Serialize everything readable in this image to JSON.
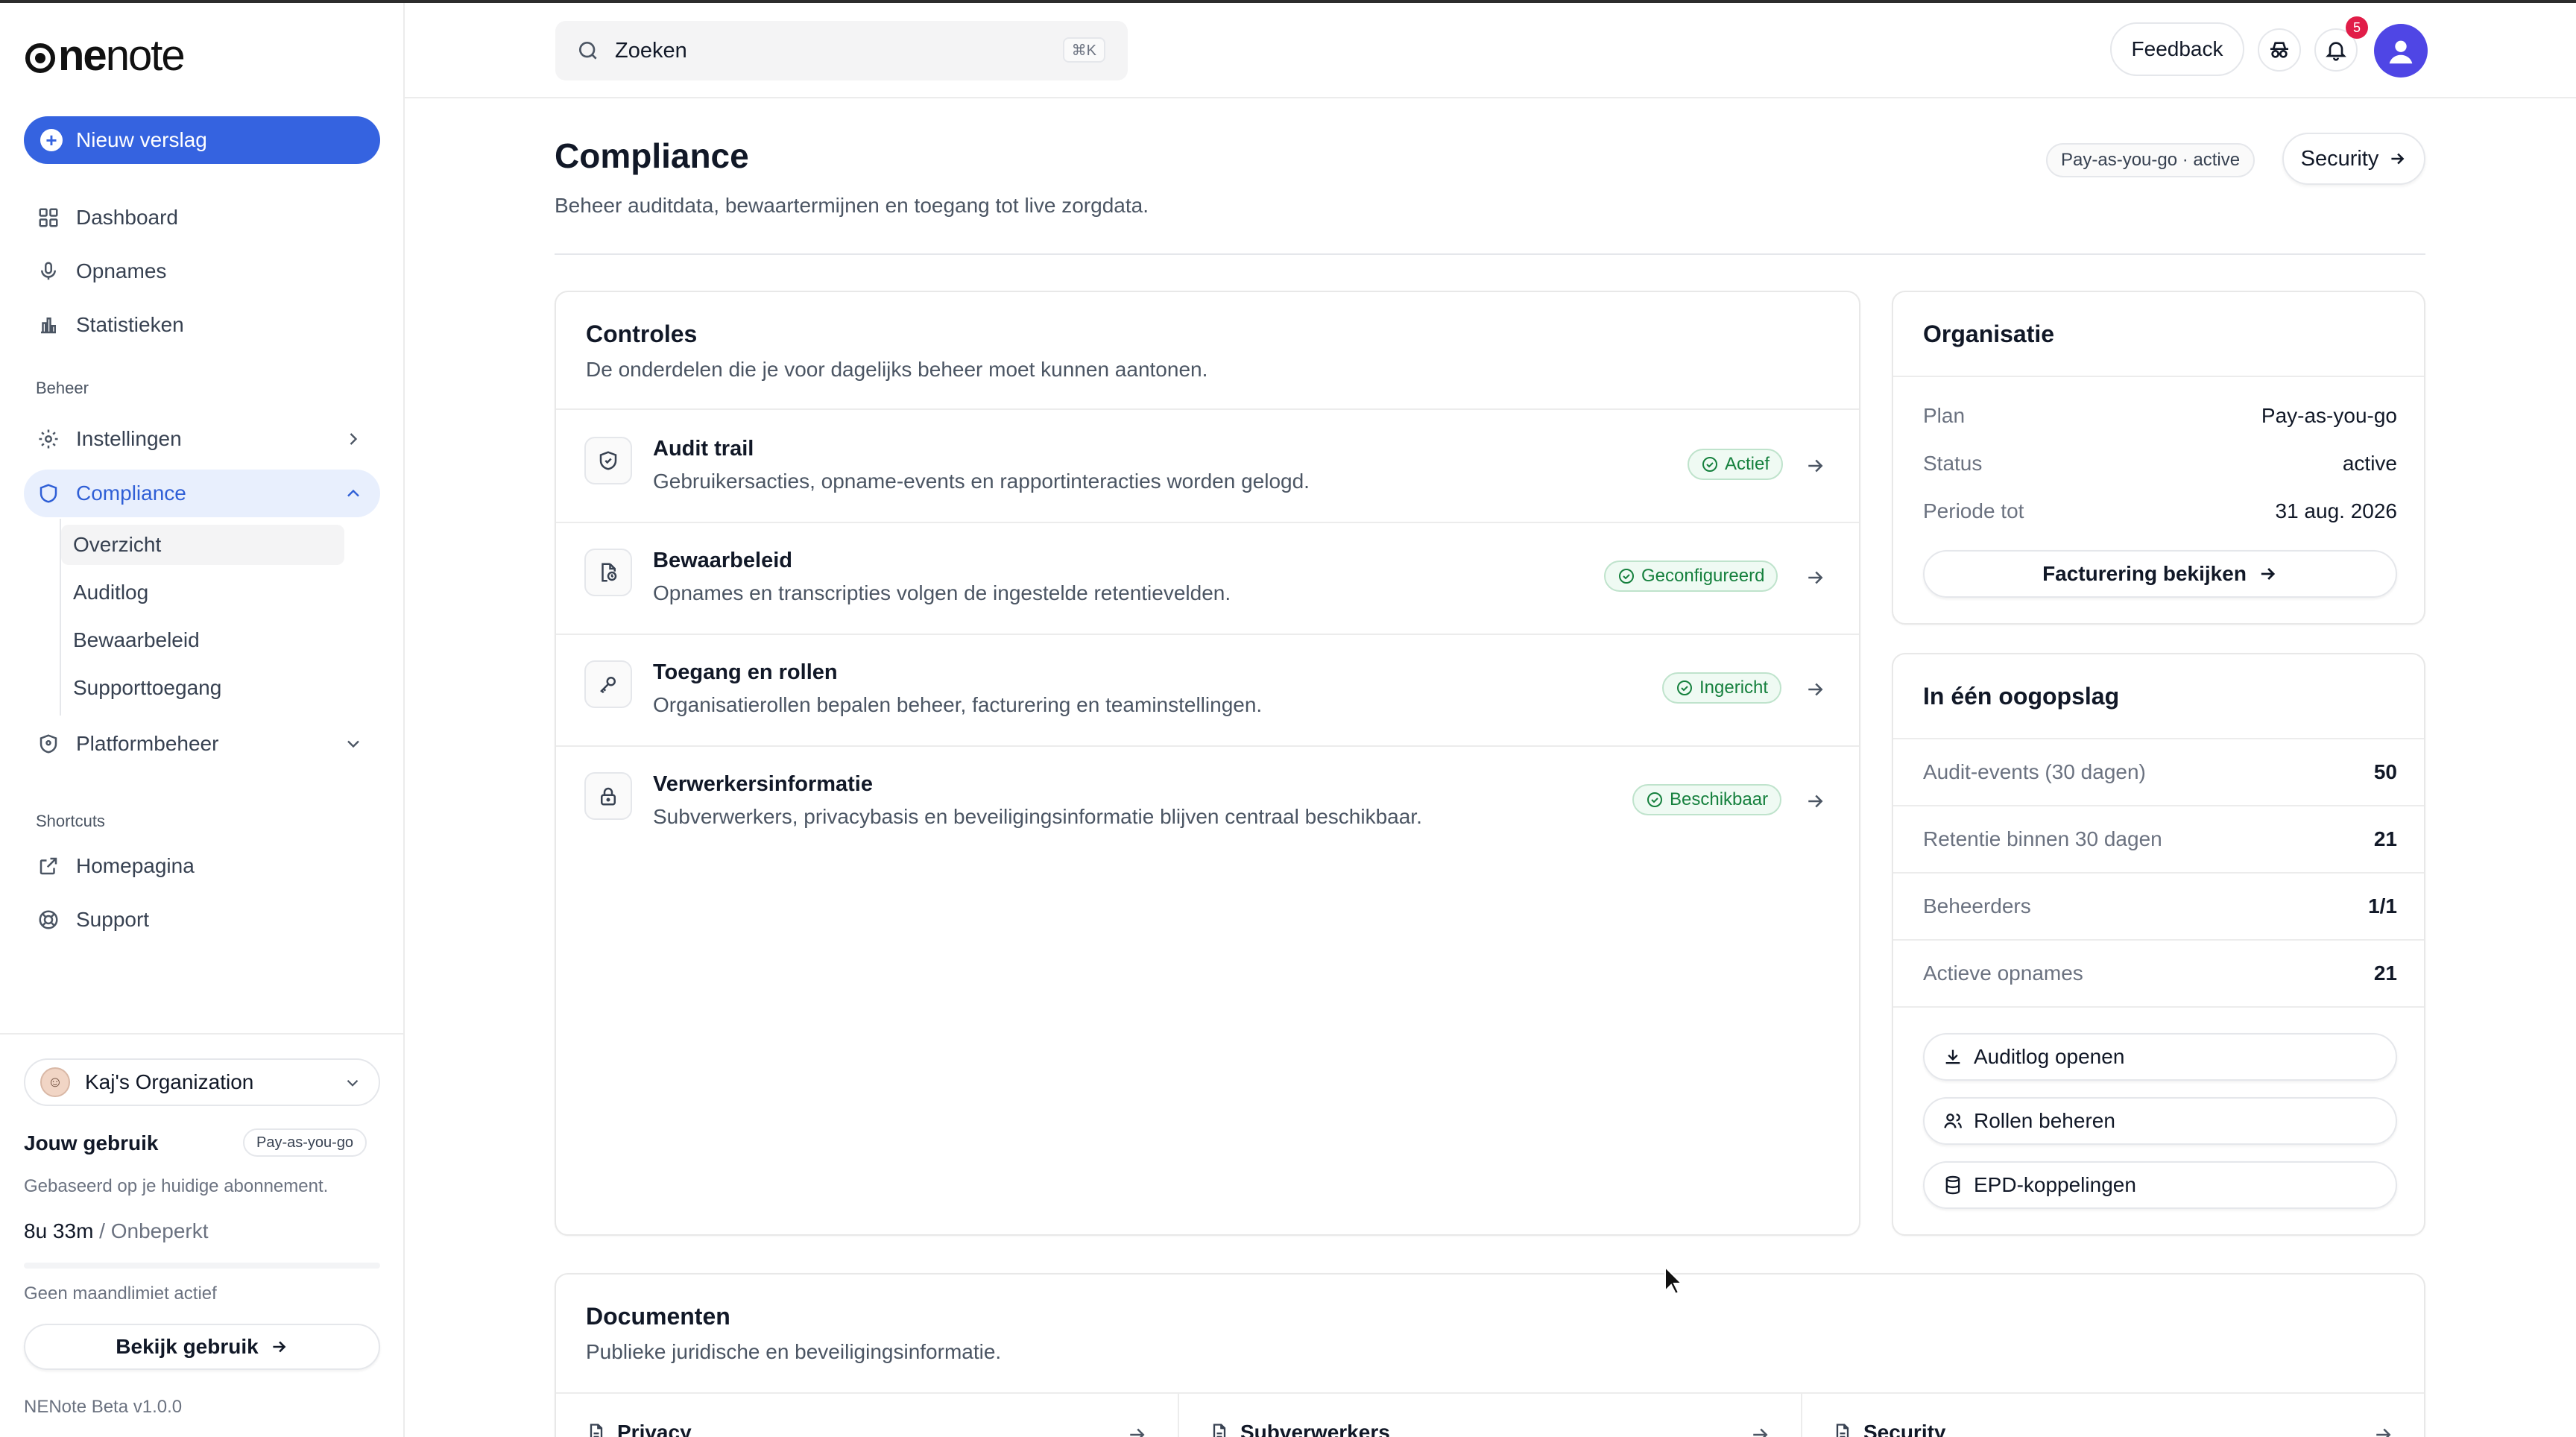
{
  "app": {
    "logo": "onenote",
    "version": "NENote Beta v1.0.0"
  },
  "sidebar": {
    "new_report": "Nieuw verslag",
    "items": [
      {
        "label": "Dashboard",
        "icon": "grid-icon"
      },
      {
        "label": "Opnames",
        "icon": "microphone-icon"
      },
      {
        "label": "Statistieken",
        "icon": "bar-chart-icon"
      }
    ],
    "section_beheer": "Beheer",
    "beheer_items": [
      {
        "label": "Instellingen",
        "icon": "gear-icon"
      },
      {
        "label": "Compliance",
        "icon": "shield-icon"
      },
      {
        "label": "Platformbeheer",
        "icon": "shield-check-icon"
      }
    ],
    "compliance_sub": [
      "Overzicht",
      "Auditlog",
      "Bewaarbeleid",
      "Supporttoegang"
    ],
    "section_shortcuts": "Shortcuts",
    "shortcuts": [
      {
        "label": "Homepagina",
        "icon": "external-link-icon"
      },
      {
        "label": "Support",
        "icon": "lifebuoy-icon"
      }
    ],
    "org": "Kaj's Organization",
    "usage": {
      "title": "Jouw gebruik",
      "badge": "Pay-as-you-go",
      "desc": "Gebaseerd op je huidige abonnement.",
      "amount": "8u 33m",
      "amount_sep": " / ",
      "limit": "Onbeperkt",
      "no_limit": "Geen maandlimiet actief",
      "button": "Bekijk gebruik"
    }
  },
  "topbar": {
    "search_placeholder": "Zoeken",
    "shortcut": "⌘K",
    "feedback": "Feedback",
    "notifications_count": "5"
  },
  "page": {
    "title": "Compliance",
    "subtitle": "Beheer auditdata, bewaartermijnen en toegang tot live zorgdata.",
    "plan_pill": "Pay-as-you-go · active",
    "security_button": "Security"
  },
  "controls": {
    "title": "Controles",
    "subtitle": "De onderdelen die je voor dagelijks beheer moet kunnen aantonen.",
    "rows": [
      {
        "title": "Audit trail",
        "desc": "Gebruikersacties, opname-events en rapportinteracties worden gelogd.",
        "status": "Actief",
        "icon": "shield-icon"
      },
      {
        "title": "Bewaarbeleid",
        "desc": "Opnames en transcripties volgen de ingestelde retentievelden.",
        "status": "Geconfigureerd",
        "icon": "file-clock-icon"
      },
      {
        "title": "Toegang en rollen",
        "desc": "Organisatierollen bepalen beheer, facturering en teaminstellingen.",
        "status": "Ingericht",
        "icon": "key-icon"
      },
      {
        "title": "Verwerkersinformatie",
        "desc": "Subverwerkers, privacybasis en beveiligingsinformatie blijven centraal beschikbaar.",
        "status": "Beschikbaar",
        "icon": "lock-icon"
      }
    ],
    "status_color": "#15803d"
  },
  "organisation": {
    "title": "Organisatie",
    "rows": [
      {
        "k": "Plan",
        "v": "Pay-as-you-go"
      },
      {
        "k": "Status",
        "v": "active"
      },
      {
        "k": "Periode tot",
        "v": "31 aug. 2026"
      }
    ],
    "billing_button": "Facturering bekijken"
  },
  "glance": {
    "title": "In één oogopslag",
    "rows": [
      {
        "k": "Audit-events (30 dagen)",
        "v": "50"
      },
      {
        "k": "Retentie binnen 30 dagen",
        "v": "21"
      },
      {
        "k": "Beheerders",
        "v": "1/1"
      },
      {
        "k": "Actieve opnames",
        "v": "21"
      }
    ],
    "buttons": [
      {
        "label": "Auditlog openen",
        "icon": "download-icon"
      },
      {
        "label": "Rollen beheren",
        "icon": "users-icon"
      },
      {
        "label": "EPD-koppelingen",
        "icon": "database-icon"
      }
    ]
  },
  "documents": {
    "title": "Documenten",
    "subtitle": "Publieke juridische en beveiligingsinformatie.",
    "items": [
      "Privacy",
      "Subverwerkers",
      "Security"
    ]
  },
  "colors": {
    "accent": "#3563e0",
    "active_bg": "#e8effd",
    "success": "#15803d",
    "badge": "#e11d48"
  }
}
